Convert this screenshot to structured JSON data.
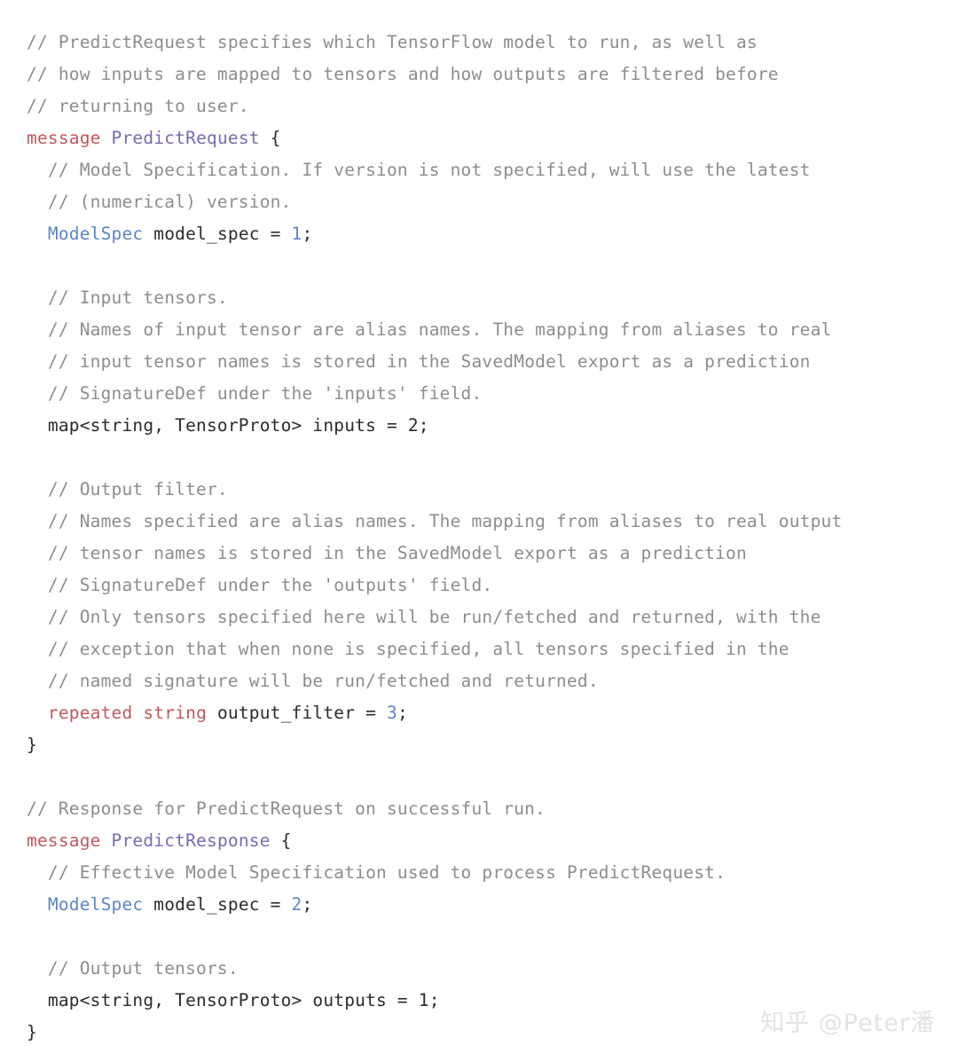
{
  "document": {
    "language": "protobuf",
    "background_color": "#ffffff",
    "colors": {
      "comment": "#8d8d8d",
      "keyword": "#c2595c",
      "message_name": "#6f6fb4",
      "type_name": "#5d85c6",
      "number": "#5d85c6",
      "plain_text": "#2b2b2b",
      "watermark": "#e3e3e3"
    }
  },
  "watermark": {
    "text": "知乎 @Peter潘"
  },
  "code": {
    "lines": [
      {
        "indent": 0,
        "tokens": [
          {
            "t": "comment",
            "v": "// PredictRequest specifies which TensorFlow model to run, as well as"
          }
        ]
      },
      {
        "indent": 0,
        "tokens": [
          {
            "t": "comment",
            "v": "// how inputs are mapped to tensors and how outputs are filtered before"
          }
        ]
      },
      {
        "indent": 0,
        "tokens": [
          {
            "t": "comment",
            "v": "// returning to user."
          }
        ]
      },
      {
        "indent": 0,
        "tokens": [
          {
            "t": "keyword",
            "v": "message"
          },
          {
            "t": "plain",
            "v": " "
          },
          {
            "t": "typename",
            "v": "PredictRequest"
          },
          {
            "t": "punct",
            "v": " {"
          }
        ]
      },
      {
        "indent": 1,
        "tokens": [
          {
            "t": "comment",
            "v": "// Model Specification. If version is not specified, will use the latest"
          }
        ]
      },
      {
        "indent": 1,
        "tokens": [
          {
            "t": "comment",
            "v": "// (numerical) version."
          }
        ]
      },
      {
        "indent": 1,
        "tokens": [
          {
            "t": "type",
            "v": "ModelSpec"
          },
          {
            "t": "plain",
            "v": " model_spec = "
          },
          {
            "t": "number",
            "v": "1"
          },
          {
            "t": "punct",
            "v": ";"
          }
        ]
      },
      {
        "indent": 0,
        "tokens": []
      },
      {
        "indent": 1,
        "tokens": [
          {
            "t": "comment",
            "v": "// Input tensors."
          }
        ]
      },
      {
        "indent": 1,
        "tokens": [
          {
            "t": "comment",
            "v": "// Names of input tensor are alias names. The mapping from aliases to real"
          }
        ]
      },
      {
        "indent": 1,
        "tokens": [
          {
            "t": "comment",
            "v": "// input tensor names is stored in the SavedModel export as a prediction"
          }
        ]
      },
      {
        "indent": 1,
        "tokens": [
          {
            "t": "comment",
            "v": "// SignatureDef under the 'inputs' field."
          }
        ]
      },
      {
        "indent": 1,
        "tokens": [
          {
            "t": "plain",
            "v": "map<string, TensorProto> inputs = 2;"
          }
        ]
      },
      {
        "indent": 0,
        "tokens": []
      },
      {
        "indent": 1,
        "tokens": [
          {
            "t": "comment",
            "v": "// Output filter."
          }
        ]
      },
      {
        "indent": 1,
        "tokens": [
          {
            "t": "comment",
            "v": "// Names specified are alias names. The mapping from aliases to real output"
          }
        ]
      },
      {
        "indent": 1,
        "tokens": [
          {
            "t": "comment",
            "v": "// tensor names is stored in the SavedModel export as a prediction"
          }
        ]
      },
      {
        "indent": 1,
        "tokens": [
          {
            "t": "comment",
            "v": "// SignatureDef under the 'outputs' field."
          }
        ]
      },
      {
        "indent": 1,
        "tokens": [
          {
            "t": "comment",
            "v": "// Only tensors specified here will be run/fetched and returned, with the"
          }
        ]
      },
      {
        "indent": 1,
        "tokens": [
          {
            "t": "comment",
            "v": "// exception that when none is specified, all tensors specified in the"
          }
        ]
      },
      {
        "indent": 1,
        "tokens": [
          {
            "t": "comment",
            "v": "// named signature will be run/fetched and returned."
          }
        ]
      },
      {
        "indent": 1,
        "tokens": [
          {
            "t": "keyword",
            "v": "repeated"
          },
          {
            "t": "plain",
            "v": " "
          },
          {
            "t": "keyword",
            "v": "string"
          },
          {
            "t": "plain",
            "v": " output_filter = "
          },
          {
            "t": "number",
            "v": "3"
          },
          {
            "t": "punct",
            "v": ";"
          }
        ]
      },
      {
        "indent": 0,
        "tokens": [
          {
            "t": "punct",
            "v": "}"
          }
        ]
      },
      {
        "indent": 0,
        "tokens": []
      },
      {
        "indent": 0,
        "tokens": [
          {
            "t": "comment",
            "v": "// Response for PredictRequest on successful run."
          }
        ]
      },
      {
        "indent": 0,
        "tokens": [
          {
            "t": "keyword",
            "v": "message"
          },
          {
            "t": "plain",
            "v": " "
          },
          {
            "t": "typename",
            "v": "PredictResponse"
          },
          {
            "t": "punct",
            "v": " {"
          }
        ]
      },
      {
        "indent": 1,
        "tokens": [
          {
            "t": "comment",
            "v": "// Effective Model Specification used to process PredictRequest."
          }
        ]
      },
      {
        "indent": 1,
        "tokens": [
          {
            "t": "type",
            "v": "ModelSpec"
          },
          {
            "t": "plain",
            "v": " model_spec = "
          },
          {
            "t": "number",
            "v": "2"
          },
          {
            "t": "punct",
            "v": ";"
          }
        ]
      },
      {
        "indent": 0,
        "tokens": []
      },
      {
        "indent": 1,
        "tokens": [
          {
            "t": "comment",
            "v": "// Output tensors."
          }
        ]
      },
      {
        "indent": 1,
        "tokens": [
          {
            "t": "plain",
            "v": "map<string, TensorProto> outputs = 1;"
          }
        ]
      },
      {
        "indent": 0,
        "tokens": [
          {
            "t": "punct",
            "v": "}"
          }
        ]
      }
    ]
  }
}
